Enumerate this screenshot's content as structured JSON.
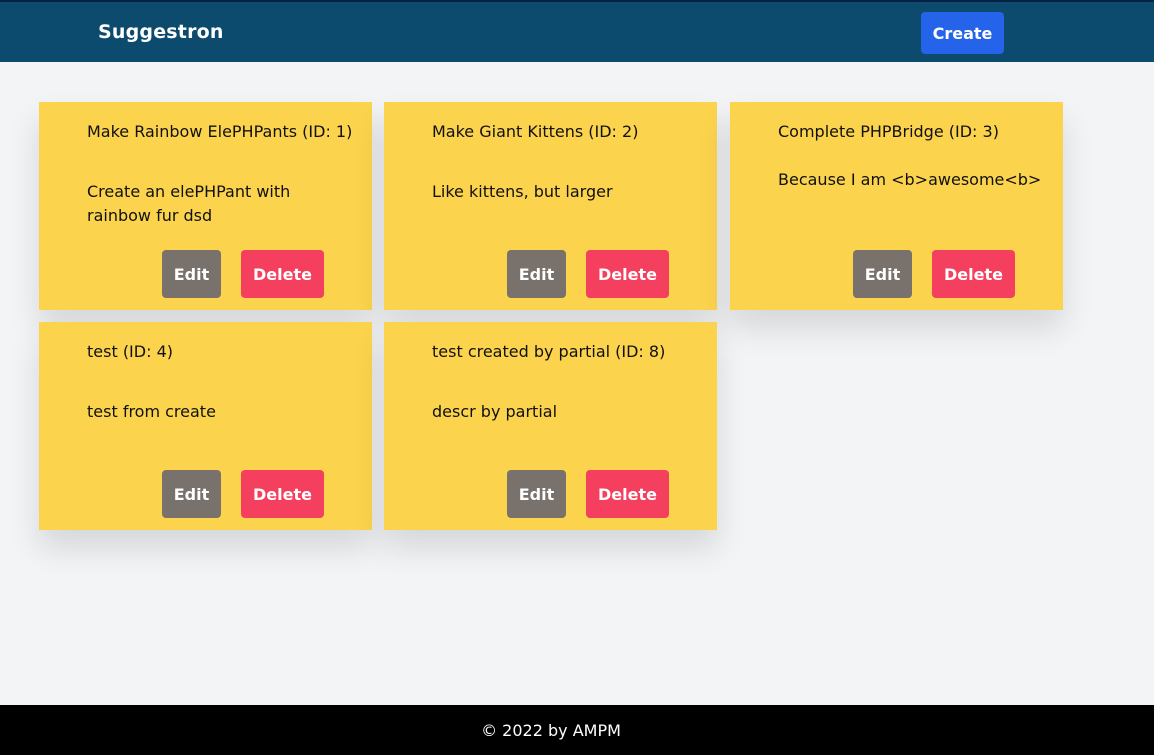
{
  "header": {
    "brand": "Suggestron",
    "create_label": "Create"
  },
  "cards": [
    {
      "title": "Make Rainbow ElePHPants (ID: 1)",
      "description": "Create an elePHPant with rainbow fur dsd",
      "edit_label": "Edit",
      "delete_label": "Delete"
    },
    {
      "title": "Make Giant Kittens (ID: 2)",
      "description": "Like kittens, but larger",
      "edit_label": "Edit",
      "delete_label": "Delete"
    },
    {
      "title": "Complete PHPBridge (ID: 3)",
      "description": "Because I am <b>awesome<b>",
      "edit_label": "Edit",
      "delete_label": "Delete"
    },
    {
      "title": "test (ID: 4)",
      "description": "test from create",
      "edit_label": "Edit",
      "delete_label": "Delete"
    },
    {
      "title": "test created by partial (ID: 8)",
      "description": "descr by partial",
      "edit_label": "Edit",
      "delete_label": "Delete"
    }
  ],
  "footer": {
    "text": "© 2022 by AMPM"
  },
  "colors": {
    "header_bg": "#0c4a6e",
    "create_button": "#2563eb",
    "card_bg": "#fcd34d",
    "edit_button": "#78716c",
    "delete_button": "#f43f5e",
    "footer_bg": "#000000",
    "page_bg": "#f3f4f6"
  }
}
